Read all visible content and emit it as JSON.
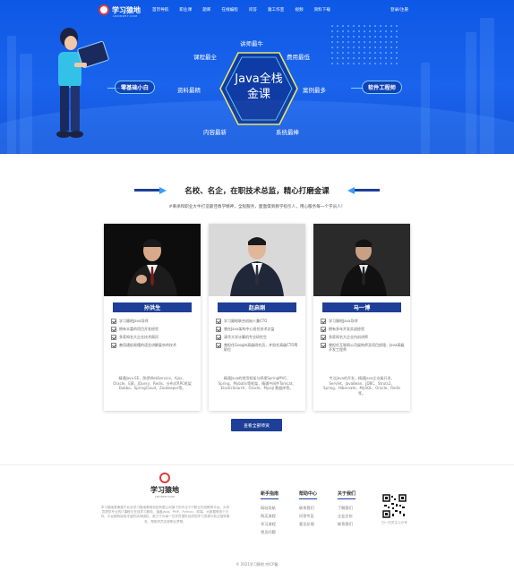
{
  "nav": {
    "logo_text": "学习猿地",
    "logo_sub": "LMONKEY.COM",
    "items": [
      "首页导航",
      "职业课",
      "题库",
      "在线编程",
      "问答",
      "猿工作室",
      "视频",
      "资料下载"
    ],
    "login": "登录/注册"
  },
  "hero": {
    "center_title_line1": "Java全栈",
    "center_title_line2": "金课",
    "tags": [
      "讲师最牛",
      "课程最全",
      "费用最低",
      "资料最精",
      "案例最多",
      "内容最新",
      "系统最棒"
    ],
    "left_pill": "零基础小白",
    "right_pill": "软件工程师"
  },
  "section": {
    "title": "名校、名企，在职技术总监，精心打磨金课",
    "subtitle": "#秉承和职业大牛打造最佳教学精神，全程服务，面面俱到教学指引人，用心服务每一个学员人！"
  },
  "teachers": [
    {
      "name": "孙洪生",
      "points": [
        "学习猿地Java导师",
        "拥有丰富的项目开发经验",
        "多家知名大企业技术顾问",
        "善用通俗易懂的语言讲解复杂的技术"
      ],
      "desc": "精通Java EE，熟悉WebService、Ajax、Oracle、EJB、JQuery、Redis、分布式RPC框架Dubbo、SpringCloud、Zookeeper等。"
    },
    {
      "name": "赵启刚",
      "points": [
        "学习猿地联合创始人兼CTO",
        "曾在Java架构中心担任技术总监",
        "清华大学计算机专业研究生",
        "曾担任Google高级研究员，并担任高级CTO等职位"
      ],
      "desc": "精通Java的常用框架与原理SpringMVC、Spring、Mybatis等框架，精通中间件Tomcat、ElasticSearch、Oracle、Mysql 数据库等。"
    },
    {
      "name": "马一博",
      "points": [
        "学习猿地Java导师",
        "拥有多年开发实战经验",
        "多家知名大企业内训讲师",
        "曾担任互联网公司架构师及项目经理，Java高级开发工程师"
      ],
      "desc": "专注Java的开发，精通Java企业级开发，Servlet、JavaBean、JDBC、Struts2、Spring、Hibernate、MySQL、Oracle、Redis等。"
    }
  ],
  "more_button": "查看全部师资",
  "footer": {
    "logo_text": "学习猿地",
    "logo_sub": "LMONKEY.COM",
    "description": "学习猿地是隶属于北京学习猿地教育科技有限公司旗下的专注于IT职业在线教育平台。为学员提供专业的IT课程与在线学习服务，涵盖Java、PHP、Python、前端、大数据等多个方向。平台拥有经验丰富的讲师团队，致力于为每一位学员提供优质的学习资源与就业指导服务，帮助学员实现职业梦想。",
    "columns": [
      {
        "title": "新手指南",
        "links": [
          "网站导航",
          "购买流程",
          "学习流程",
          "常见问题"
        ]
      },
      {
        "title": "帮助中心",
        "links": [
          "联系我们",
          "问答专区",
          "意见反馈"
        ]
      },
      {
        "title": "关于我们",
        "links": [
          "了解我们",
          "企业文化",
          "联系我们"
        ]
      }
    ],
    "qr_caption": "扫一扫关注公众号",
    "copyright": "© 2021学习猿地 京ICP备"
  }
}
